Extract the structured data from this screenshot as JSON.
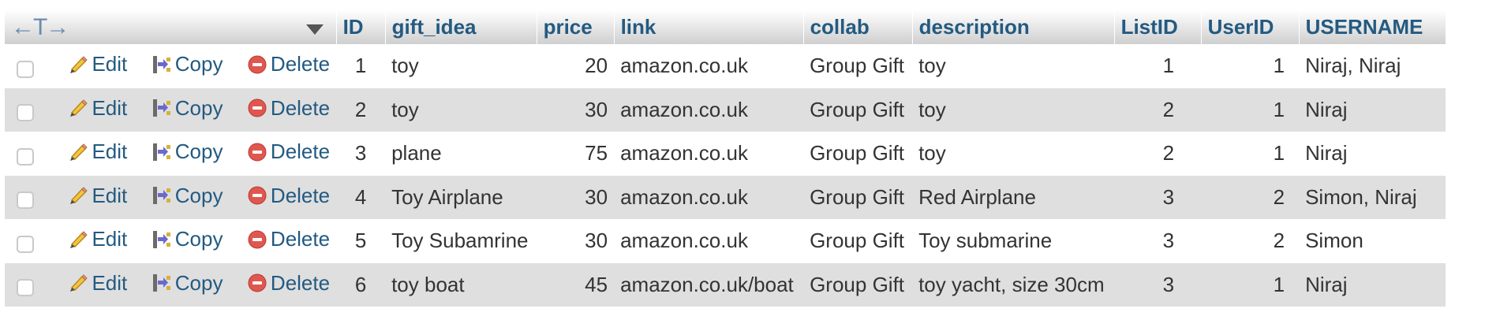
{
  "header": {
    "arrows": "←T→",
    "columns": [
      "ID",
      "gift_idea",
      "price",
      "link",
      "collab",
      "description",
      "ListID",
      "UserID",
      "USERNAME"
    ]
  },
  "actions": {
    "edit": "Edit",
    "copy": "Copy",
    "delete": "Delete"
  },
  "icons": {
    "edit": "pencil-icon",
    "copy": "copy-icon",
    "delete": "delete-icon",
    "sort": "sort-triangle-icon"
  },
  "colors": {
    "link": "#235a81",
    "row_alt": "#dfdfdf",
    "delete_icon": "#e0574f"
  },
  "rows": [
    {
      "id": "1",
      "gift_idea": "toy",
      "price": "20",
      "link": "amazon.co.uk",
      "collab": "Group Gift",
      "description": "toy",
      "list_id": "1",
      "user_id": "1",
      "username": "Niraj, Niraj"
    },
    {
      "id": "2",
      "gift_idea": "toy",
      "price": "30",
      "link": "amazon.co.uk",
      "collab": "Group Gift",
      "description": "toy",
      "list_id": "2",
      "user_id": "1",
      "username": "Niraj"
    },
    {
      "id": "3",
      "gift_idea": "plane",
      "price": "75",
      "link": "amazon.co.uk",
      "collab": "Group Gift",
      "description": "toy",
      "list_id": "2",
      "user_id": "1",
      "username": "Niraj"
    },
    {
      "id": "4",
      "gift_idea": "Toy Airplane",
      "price": "30",
      "link": "amazon.co.uk",
      "collab": "Group Gift",
      "description": "Red Airplane",
      "list_id": "3",
      "user_id": "2",
      "username": "Simon, Niraj"
    },
    {
      "id": "5",
      "gift_idea": "Toy Subamrine",
      "price": "30",
      "link": "amazon.co.uk",
      "collab": "Group Gift",
      "description": "Toy submarine",
      "list_id": "3",
      "user_id": "2",
      "username": "Simon"
    },
    {
      "id": "6",
      "gift_idea": "toy boat",
      "price": "45",
      "link": "amazon.co.uk/boat",
      "collab": "Group Gift",
      "description": "toy yacht, size 30cm",
      "list_id": "3",
      "user_id": "1",
      "username": "Niraj"
    }
  ]
}
